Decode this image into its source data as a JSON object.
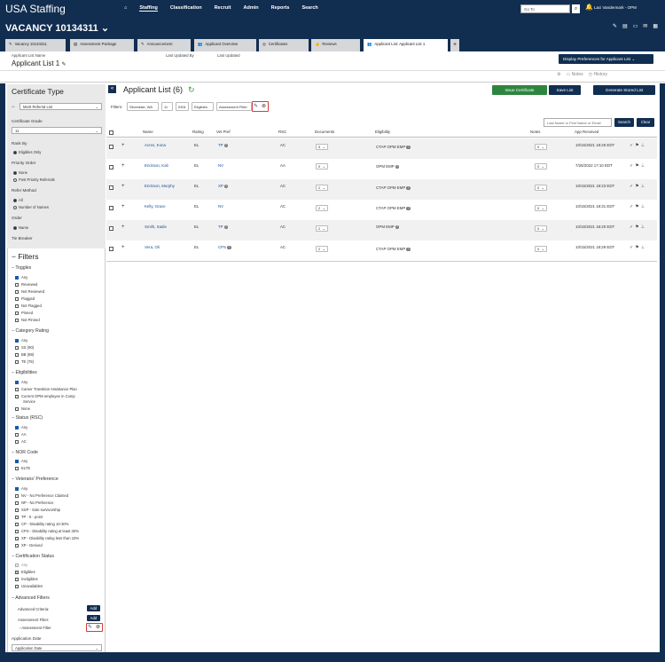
{
  "topbar": {
    "brand": "USA Staffing",
    "nav": [
      "Staffing",
      "Classification",
      "Recruit",
      "Admin",
      "Reports",
      "Search"
    ],
    "goto_placeholder": "Go To",
    "user": "Laci Vandermark - OPM"
  },
  "vacancy": {
    "title": "VACANCY 10134311"
  },
  "tabs": [
    {
      "label": "Vacancy 10134311",
      "icon": "✎"
    },
    {
      "label": "Assessment Package",
      "icon": "▤"
    },
    {
      "label": "Announcement",
      "icon": "✎"
    },
    {
      "label": "Applicant Overview",
      "icon": "👥"
    },
    {
      "label": "Certificates",
      "icon": "◎"
    },
    {
      "label": "Reviews",
      "icon": "👍"
    },
    {
      "label": "Applicant List: Applicant List 1",
      "icon": "👥"
    }
  ],
  "header": {
    "name_label": "Applicant List Name",
    "updated_by_label": "Last Updated By",
    "updated_label": "Last Updated",
    "list_name": "Applicant List 1",
    "display_prefs": "Display Preferences for Applicant List",
    "notes": "Notes",
    "history": "History"
  },
  "left": {
    "cert_type_title": "Certificate Type",
    "cert_type_value": "Merit Referral List",
    "cert_grade_label": "Certificate Grade",
    "cert_grade_value": "11",
    "rank_by_label": "Rank By",
    "rank_by_options": [
      "Eligibles Only"
    ],
    "priority_order_label": "Priority Order",
    "priority_options": [
      "None",
      "Post Priority Referrals"
    ],
    "refer_method_label": "Refer Method",
    "refer_options": [
      "All",
      "Number of Names"
    ],
    "order_label": "Order",
    "order_options": [
      "Name"
    ],
    "tie_breaker_label": "Tie Breaker",
    "filters_title": "Filters",
    "toggles_label": "Toggles",
    "toggles": [
      "Any",
      "Reviewed",
      "Not Reviewed",
      "Flagged",
      "Not Flagged",
      "Pinned",
      "Not Pinned"
    ],
    "category_label": "Category Rating",
    "category": [
      "Any",
      "SS (90)",
      "BB (88)",
      "TE (78)"
    ],
    "elig_label": "Eligibilities",
    "elig": [
      "Any",
      "Career Transition Assistance Plan",
      "Current OPM employee in Comp",
      "Service",
      "None"
    ],
    "status_label": "Status (RSC)",
    "status": [
      "Any",
      "AA",
      "AC"
    ],
    "nor_label": "NOR Code",
    "nor": [
      "Any",
      "ELTE"
    ],
    "vet_label": "Veterans' Preference",
    "vet": [
      "Any",
      "NV - No Preference Claimed",
      "NP - No Preference",
      "SSP - Sole survivorship",
      "TP - 5 - point",
      "CP - Disability rating 10-30%",
      "CPS - Disability rating at least 30%",
      "XP - Disability rating less than 10%",
      "XP - Derived"
    ],
    "certstatus_label": "Certification Status",
    "certstatus": [
      "Any",
      "Eligibles",
      "Ineligibles",
      "Unavailables"
    ],
    "adv_label": "Advanced Filters",
    "adv_criteria": "Advanced Criteria:",
    "assess_filter": "Assessment Filter:",
    "assess_item": "Assessment Filter",
    "add": "Add",
    "app_date_label": "Application Date",
    "app_date_value": "Application Date"
  },
  "main": {
    "title": "Applicant List (6)",
    "issue_cert": "Issue Certificate",
    "save_list": "Save List",
    "gen_stored": "Generate Stored List",
    "filters_label": "Filters:",
    "chips": [
      "Silverdale, WA",
      "11",
      "0301",
      "Eligibles",
      "Assessment Filter"
    ],
    "search_placeholder": "Last Name or First Name or Email",
    "search": "Search",
    "clear": "Clear",
    "columns": [
      "Name",
      "Rating",
      "Vet Pref",
      "RSC",
      "Documents",
      "Eligibility",
      "Notes",
      "App Received"
    ],
    "rows": [
      {
        "name": "Acres, Kona",
        "rating": "EL",
        "vet": "TP",
        "rsc": "AC",
        "docs": "5",
        "elig": "CTAP   OPM EMP",
        "notes": "0",
        "rec": "10/15/2021 18:25 EDT"
      },
      {
        "name": "Erickson, Kali",
        "rating": "EL",
        "vet": "NV",
        "rsc": "AA",
        "docs": "0",
        "elig": "OPM EMP",
        "notes": "0",
        "rec": "7/26/2022 17:10 EDT"
      },
      {
        "name": "Erickson, Murphy",
        "rating": "EL",
        "vet": "XP",
        "rsc": "AC",
        "docs": "2",
        "elig": "CTAP   OPM EMP",
        "notes": "0",
        "rec": "10/15/2021 18:23 EDT"
      },
      {
        "name": "Kelly, Grace",
        "rating": "EL",
        "vet": "NV",
        "rsc": "AC",
        "docs": "2",
        "elig": "CTAP   OPM EMP",
        "notes": "0",
        "rec": "10/15/2021 18:31 EDT"
      },
      {
        "name": "Smith, Sadie",
        "rating": "EL",
        "vet": "TP",
        "rsc": "AC",
        "docs": "2",
        "elig": "OPM EMP",
        "notes": "0",
        "rec": "10/15/2021 18:20 EDT"
      },
      {
        "name": "Vera, Oli",
        "rating": "EL",
        "vet": "CPS",
        "rsc": "AC",
        "docs": "2",
        "elig": "CTAP   OPM EMP",
        "notes": "0",
        "rec": "10/15/2021 18:29 EDT"
      }
    ]
  }
}
